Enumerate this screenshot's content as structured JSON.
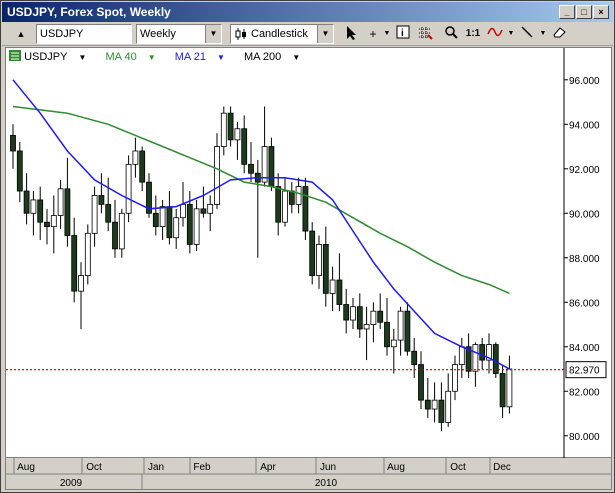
{
  "window": {
    "title": "USDJPY, Forex Spot, Weekly"
  },
  "toolbar": {
    "symbol": "USDJPY",
    "period": "Weekly",
    "chart_type": "Candlestick",
    "zoom_label": "1:1"
  },
  "legend": {
    "symbol": "USDJPY",
    "ma1": "MA 40",
    "ma2": "MA 21",
    "ma3": "MA 200"
  },
  "colors": {
    "ma40": "#2e8b2e",
    "ma21": "#1a1aff",
    "price_line": "#cc0000"
  },
  "price_label": "82.970",
  "chart_data": {
    "type": "candlestick",
    "ylim": [
      79.0,
      96.8
    ],
    "y_ticks": [
      "96.000",
      "94.000",
      "92.000",
      "90.000",
      "88.000",
      "86.000",
      "84.000",
      "82.000",
      "80.000"
    ],
    "x_ticks": [
      "Aug",
      "Oct",
      "Jan",
      "Feb",
      "Apr",
      "Jun",
      "Aug",
      "Oct",
      "Dec"
    ],
    "years": [
      "2009",
      "2010"
    ],
    "last_price": 82.97,
    "candles": [
      [
        93.5,
        94.0,
        92.0,
        92.8
      ],
      [
        92.8,
        93.2,
        90.5,
        91.0
      ],
      [
        91.0,
        91.8,
        89.5,
        90.0
      ],
      [
        90.0,
        91.0,
        89.0,
        90.6
      ],
      [
        90.6,
        91.2,
        88.8,
        89.6
      ],
      [
        89.6,
        90.2,
        88.6,
        89.4
      ],
      [
        89.4,
        90.8,
        88.2,
        89.9
      ],
      [
        89.9,
        91.5,
        89.3,
        91.1
      ],
      [
        91.1,
        92.5,
        88.5,
        89.0
      ],
      [
        89.0,
        89.8,
        86.0,
        86.5
      ],
      [
        86.5,
        87.8,
        84.8,
        87.2
      ],
      [
        87.2,
        89.5,
        86.8,
        89.1
      ],
      [
        89.1,
        91.2,
        88.5,
        90.8
      ],
      [
        90.8,
        91.8,
        90.0,
        90.4
      ],
      [
        90.4,
        91.6,
        89.2,
        89.6
      ],
      [
        89.6,
        90.6,
        88.0,
        88.4
      ],
      [
        88.4,
        90.2,
        88.0,
        90.0
      ],
      [
        90.0,
        92.6,
        89.6,
        92.2
      ],
      [
        92.2,
        93.4,
        91.6,
        92.8
      ],
      [
        92.8,
        93.0,
        91.0,
        91.4
      ],
      [
        91.4,
        91.8,
        89.8,
        90.0
      ],
      [
        90.0,
        90.8,
        89.0,
        89.4
      ],
      [
        89.4,
        90.6,
        88.8,
        90.3
      ],
      [
        90.3,
        91.0,
        88.6,
        88.9
      ],
      [
        88.9,
        90.2,
        88.4,
        89.8
      ],
      [
        89.8,
        91.4,
        89.4,
        90.4
      ],
      [
        90.4,
        91.0,
        88.2,
        88.6
      ],
      [
        88.6,
        90.6,
        88.3,
        90.2
      ],
      [
        90.2,
        91.2,
        89.8,
        90.0
      ],
      [
        90.0,
        90.8,
        89.2,
        90.4
      ],
      [
        90.4,
        93.6,
        90.2,
        93.0
      ],
      [
        93.0,
        94.8,
        92.6,
        94.5
      ],
      [
        94.5,
        94.8,
        93.0,
        93.3
      ],
      [
        93.3,
        94.1,
        92.4,
        93.8
      ],
      [
        93.8,
        94.4,
        91.8,
        92.2
      ],
      [
        92.2,
        93.2,
        91.4,
        91.8
      ],
      [
        91.8,
        92.4,
        88.0,
        91.4
      ],
      [
        91.4,
        94.8,
        91.2,
        93.0
      ],
      [
        93.0,
        93.4,
        91.0,
        91.2
      ],
      [
        91.2,
        91.8,
        89.0,
        89.6
      ],
      [
        89.6,
        91.6,
        89.4,
        91.0
      ],
      [
        91.0,
        91.4,
        90.0,
        90.4
      ],
      [
        90.4,
        91.6,
        90.0,
        91.2
      ],
      [
        91.2,
        91.6,
        88.8,
        89.2
      ],
      [
        89.2,
        89.6,
        86.8,
        87.2
      ],
      [
        87.2,
        89.0,
        86.6,
        88.6
      ],
      [
        88.6,
        89.4,
        85.8,
        86.4
      ],
      [
        86.4,
        87.6,
        85.6,
        87.0
      ],
      [
        87.0,
        88.2,
        85.6,
        85.9
      ],
      [
        85.9,
        86.6,
        84.6,
        85.2
      ],
      [
        85.2,
        86.2,
        84.8,
        85.8
      ],
      [
        85.8,
        86.4,
        84.4,
        84.8
      ],
      [
        84.8,
        85.8,
        83.4,
        85.0
      ],
      [
        85.0,
        86.0,
        84.2,
        85.6
      ],
      [
        85.6,
        86.4,
        84.8,
        85.1
      ],
      [
        85.1,
        86.2,
        83.6,
        84.0
      ],
      [
        84.0,
        84.8,
        82.8,
        84.3
      ],
      [
        84.3,
        85.8,
        83.6,
        85.6
      ],
      [
        85.6,
        86.0,
        83.6,
        83.8
      ],
      [
        83.8,
        84.4,
        82.6,
        83.2
      ],
      [
        83.2,
        83.8,
        81.2,
        81.6
      ],
      [
        81.6,
        82.6,
        80.8,
        81.2
      ],
      [
        81.2,
        82.4,
        80.6,
        81.6
      ],
      [
        81.6,
        82.4,
        80.2,
        80.6
      ],
      [
        80.6,
        82.8,
        80.4,
        82.0
      ],
      [
        82.0,
        83.6,
        81.6,
        83.2
      ],
      [
        83.2,
        84.4,
        82.6,
        84.0
      ],
      [
        84.0,
        84.6,
        82.6,
        82.9
      ],
      [
        82.9,
        84.2,
        82.2,
        84.1
      ],
      [
        84.1,
        84.4,
        83.0,
        83.4
      ],
      [
        83.4,
        84.6,
        82.8,
        84.1
      ],
      [
        84.1,
        84.2,
        82.6,
        82.8
      ],
      [
        82.8,
        83.2,
        80.8,
        81.3
      ],
      [
        81.3,
        83.6,
        81.0,
        83.0
      ]
    ],
    "ma40": [
      [
        0,
        94.8
      ],
      [
        8,
        94.5
      ],
      [
        14,
        94.0
      ],
      [
        18,
        93.5
      ],
      [
        22,
        93.0
      ],
      [
        26,
        92.5
      ],
      [
        30,
        92.0
      ],
      [
        34,
        91.4
      ],
      [
        38,
        91.2
      ],
      [
        42,
        90.9
      ],
      [
        46,
        90.5
      ],
      [
        50,
        89.8
      ],
      [
        54,
        89.1
      ],
      [
        58,
        88.5
      ],
      [
        62,
        87.8
      ],
      [
        66,
        87.2
      ],
      [
        70,
        86.8
      ],
      [
        73,
        86.4
      ]
    ],
    "ma21": [
      [
        0,
        96.0
      ],
      [
        4,
        94.5
      ],
      [
        8,
        92.8
      ],
      [
        12,
        91.5
      ],
      [
        16,
        90.8
      ],
      [
        20,
        90.2
      ],
      [
        24,
        90.3
      ],
      [
        28,
        90.8
      ],
      [
        32,
        91.5
      ],
      [
        36,
        91.6
      ],
      [
        40,
        91.6
      ],
      [
        44,
        91.4
      ],
      [
        47,
        90.6
      ],
      [
        50,
        89.2
      ],
      [
        53,
        87.8
      ],
      [
        56,
        86.6
      ],
      [
        59,
        85.6
      ],
      [
        62,
        84.6
      ],
      [
        66,
        84.0
      ],
      [
        70,
        83.5
      ],
      [
        73,
        83.0
      ]
    ]
  }
}
